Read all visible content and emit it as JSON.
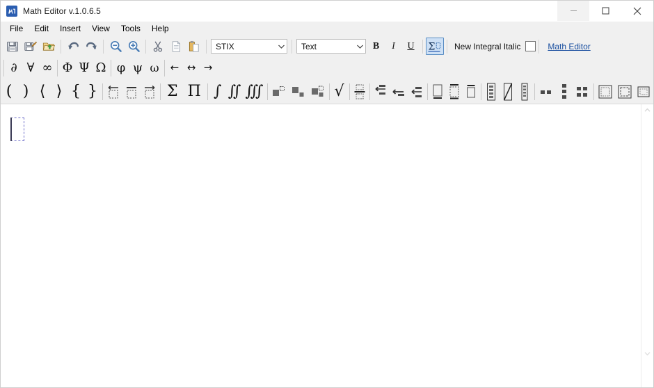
{
  "window": {
    "title": "Math Editor v.1.0.6.5",
    "app_icon": "math-editor-logo-icon",
    "controls": {
      "minimize": "minimize-icon",
      "maximize": "maximize-icon",
      "close": "close-icon"
    }
  },
  "menubar": {
    "items": [
      {
        "label": "File"
      },
      {
        "label": "Edit"
      },
      {
        "label": "Insert"
      },
      {
        "label": "View"
      },
      {
        "label": "Tools"
      },
      {
        "label": "Help"
      }
    ]
  },
  "toolbar": {
    "buttons": [
      {
        "name": "save-button",
        "icon": "floppy-disk-icon",
        "tip": "Save"
      },
      {
        "name": "save-as-button",
        "icon": "floppy-disk-pencil-icon",
        "tip": "Save As"
      },
      {
        "name": "open-button",
        "icon": "folder-open-icon",
        "tip": "Open"
      },
      {
        "name": "undo-button",
        "icon": "undo-arrow-icon",
        "tip": "Undo"
      },
      {
        "name": "redo-button",
        "icon": "redo-arrow-icon",
        "tip": "Redo"
      },
      {
        "name": "zoom-out-button",
        "icon": "magnifier-minus-icon",
        "tip": "Zoom Out"
      },
      {
        "name": "zoom-in-button",
        "icon": "magnifier-plus-icon",
        "tip": "Zoom In"
      },
      {
        "name": "cut-button",
        "icon": "scissors-icon",
        "tip": "Cut"
      },
      {
        "name": "copy-button",
        "icon": "document-copy-icon",
        "tip": "Copy"
      },
      {
        "name": "paste-button",
        "icon": "clipboard-paste-icon",
        "tip": "Paste"
      }
    ],
    "font_combo": {
      "value": "STIX",
      "arrow_icon": "chevron-down-icon"
    },
    "style_combo": {
      "value": "Text",
      "arrow_icon": "chevron-down-icon"
    },
    "bold_label": "B",
    "italic_label": "I",
    "underline_label": "U",
    "math_mode": {
      "icon": "sigma-box-icon",
      "selected": true
    },
    "integral_style_label": "New Integral Italic",
    "integral_style_checked": false,
    "brand_link": "Math Editor"
  },
  "symbol_row_1": {
    "groups": [
      {
        "name": "operators",
        "symbols": [
          {
            "glyph": "∂",
            "name": "partial-derivative-symbol"
          },
          {
            "glyph": "∀",
            "name": "for-all-symbol"
          },
          {
            "glyph": "∞",
            "name": "infinity-symbol"
          }
        ]
      },
      {
        "name": "greek-uppercase",
        "symbols": [
          {
            "glyph": "Φ",
            "name": "greek-capital-phi-symbol"
          },
          {
            "glyph": "Ψ",
            "name": "greek-capital-psi-symbol"
          },
          {
            "glyph": "Ω",
            "name": "greek-capital-omega-symbol"
          }
        ]
      },
      {
        "name": "greek-lowercase",
        "symbols": [
          {
            "glyph": "φ",
            "name": "greek-small-phi-symbol"
          },
          {
            "glyph": "ψ",
            "name": "greek-small-psi-symbol"
          },
          {
            "glyph": "ω",
            "name": "greek-small-omega-symbol"
          }
        ]
      },
      {
        "name": "arrows",
        "symbols": [
          {
            "glyph": "←",
            "name": "left-arrow-symbol"
          },
          {
            "glyph": "↔",
            "name": "left-right-arrow-symbol"
          },
          {
            "glyph": "→",
            "name": "right-arrow-symbol"
          }
        ]
      }
    ]
  },
  "symbol_row_2": {
    "brackets": [
      {
        "glyph": "(",
        "name": "paren-left-template"
      },
      {
        "glyph": ")",
        "name": "paren-right-template"
      },
      {
        "glyph": "⟨",
        "name": "angle-bracket-left-template"
      },
      {
        "glyph": "⟩",
        "name": "angle-bracket-right-template"
      },
      {
        "glyph": "{",
        "name": "brace-left-template"
      },
      {
        "glyph": "}",
        "name": "brace-right-template"
      }
    ],
    "accents": [
      {
        "name": "overleftarrow-accent-template"
      },
      {
        "name": "overbar-accent-template"
      },
      {
        "name": "overrightarrow-accent-template"
      }
    ],
    "bigops": [
      {
        "glyph": "Σ",
        "name": "summation-template"
      },
      {
        "glyph": "Π",
        "name": "product-template"
      }
    ],
    "integrals": [
      {
        "glyph": "∫",
        "name": "single-integral-template"
      },
      {
        "glyph": "∬",
        "name": "double-integral-template"
      },
      {
        "glyph": "∭",
        "name": "triple-integral-template"
      }
    ],
    "scripts": [
      {
        "name": "superscript-template"
      },
      {
        "name": "subscript-template"
      },
      {
        "name": "sub-superscript-template"
      }
    ],
    "radicals": [
      {
        "glyph": "√",
        "name": "square-root-template"
      }
    ],
    "fractions": [
      {
        "name": "fraction-template"
      }
    ],
    "limit_arrows": [
      {
        "name": "over-left-arrow-limit-template"
      },
      {
        "name": "left-arrow-limit-template"
      },
      {
        "name": "under-left-arrow-limit-template"
      }
    ],
    "underover": [
      {
        "name": "underline-box-template"
      },
      {
        "name": "over-under-line-box-template"
      },
      {
        "name": "overline-box-template"
      }
    ],
    "matrices_small": [
      {
        "name": "column-vector-template"
      },
      {
        "name": "diagonal-strike-template"
      },
      {
        "name": "single-column-matrix-template"
      }
    ],
    "grids": [
      {
        "name": "one-by-two-matrix-template"
      },
      {
        "name": "three-by-one-matrix-template"
      },
      {
        "name": "two-by-two-matrix-template"
      }
    ],
    "boxes": [
      {
        "name": "dashed-box-template"
      },
      {
        "name": "framed-box-template"
      },
      {
        "name": "small-dashed-box-template"
      }
    ]
  },
  "document": {
    "caret_placeholder": "empty-formula-slot",
    "content": ""
  },
  "scrollbar": {
    "up_icon": "scroll-up-arrow-icon",
    "down_icon": "scroll-down-arrow-icon"
  },
  "colors": {
    "accent": "#2a5db0",
    "link": "#1a4fa0",
    "selection": "#cde0f5",
    "caret": "#6b6bc9",
    "chrome": "#f0f0f0"
  }
}
